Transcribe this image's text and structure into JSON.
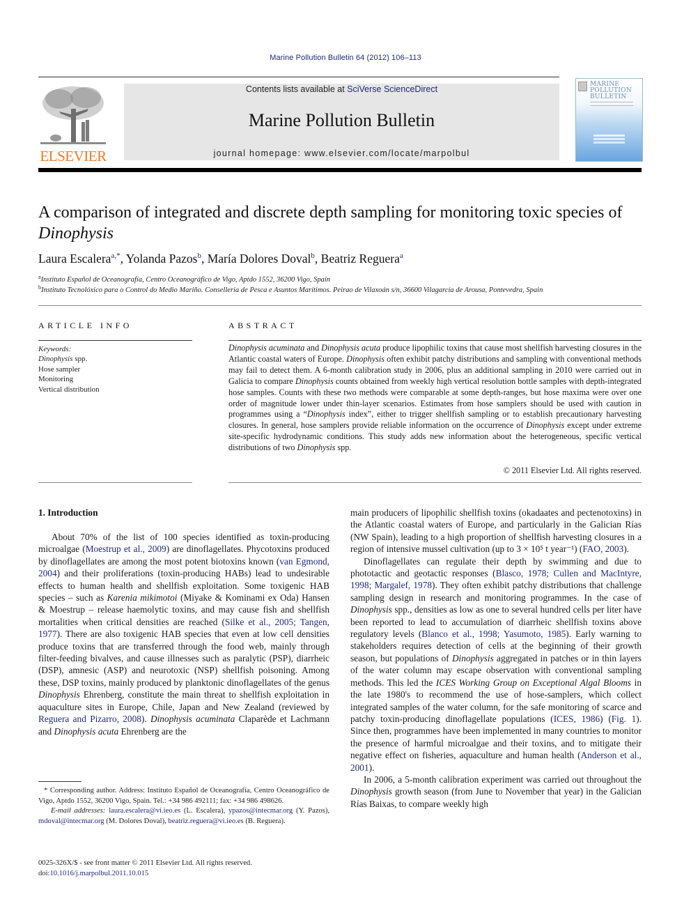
{
  "header": {
    "citation": "Marine Pollution Bulletin 64 (2012) 106–113",
    "contents_prefix": "Contents lists available at ",
    "contents_link": "SciVerse ScienceDirect",
    "journal_title": "Marine Pollution Bulletin",
    "homepage": "journal homepage: www.elsevier.com/locate/marpolbul",
    "publisher_logo_text": "ELSEVIER",
    "cover_title": "MARINE POLLUTION BULLETIN",
    "colors": {
      "link": "#1d2a7a",
      "elsevier_orange": "#f07a24",
      "banner_bg": "#e6e6e6"
    }
  },
  "article": {
    "title_main": "A comparison of integrated and discrete depth sampling for monitoring toxic species of ",
    "title_italic": "Dinophysis",
    "authors": [
      {
        "name": "Laura Escalera",
        "sup": "a,*"
      },
      {
        "name": "Yolanda Pazos",
        "sup": "b"
      },
      {
        "name": "María Dolores Doval",
        "sup": "b"
      },
      {
        "name": "Beatriz Reguera",
        "sup": "a"
      }
    ],
    "affiliations": [
      {
        "sup": "a",
        "text": "Instituto Español de Oceanografía, Centro Oceanográfico de Vigo, Aptdo 1552, 36200 Vigo, Spain"
      },
      {
        "sup": "b",
        "text": "Instituto Tecnolóxico para o Control do Medio Mariño. Conselleria de Pesca e Asuntos Marítimos. Peirao de Vilaxoán s/n, 36600 Vilagarcía de Arousa, Pontevedra, Spain"
      }
    ]
  },
  "article_info": {
    "heading": "ARTICLE INFO",
    "keywords_label": "Keywords:",
    "keywords": [
      "Dinophysis spp.",
      "Hose sampler",
      "Monitoring",
      "Vertical distribution"
    ]
  },
  "abstract": {
    "heading": "ABSTRACT",
    "segments": [
      {
        "t": "Dinophysis acuminata",
        "i": true
      },
      {
        "t": " and ",
        "i": false
      },
      {
        "t": "Dinophysis acuta",
        "i": true
      },
      {
        "t": " produce lipophilic toxins that cause most shellfish harvesting closures in the Atlantic coastal waters of Europe. ",
        "i": false
      },
      {
        "t": "Dinophysis",
        "i": true
      },
      {
        "t": " often exhibit patchy distributions and sampling with conventional methods may fail to detect them. A 6-month calibration study in 2006, plus an additional sampling in 2010 were carried out in Galicia to compare ",
        "i": false
      },
      {
        "t": "Dinophysis",
        "i": true
      },
      {
        "t": " counts obtained from weekly high vertical resolution bottle samples with depth-integrated hose samples. Counts with these two methods were comparable at some depth-ranges, but hose maxima were over one order of magnitude lower under thin-layer scenarios. Estimates from hose samplers should be used with caution in programmes using a “",
        "i": false
      },
      {
        "t": "Dinophysis",
        "i": true
      },
      {
        "t": " index”, either to trigger shellfish sampling or to establish precautionary harvesting closures. In general, hose samplers provide reliable information on the occurrence of ",
        "i": false
      },
      {
        "t": "Dinophysis",
        "i": true
      },
      {
        "t": " except under extreme site-specific hydrodynamic conditions. This study adds new information about the heterogeneous, specific vertical distributions of two ",
        "i": false
      },
      {
        "t": "Dinophysis",
        "i": true
      },
      {
        "t": " spp.",
        "i": false
      }
    ],
    "copyright": "© 2011 Elsevier Ltd. All rights reserved."
  },
  "body": {
    "section_heading": "1. Introduction",
    "left_column": [
      [
        {
          "t": "About 70% of the list of 100 species identified as toxin-producing microalgae (",
          "k": "n"
        },
        {
          "t": "Moestrup et al., 2009",
          "k": "l"
        },
        {
          "t": ") are dinoflagellates. Phycotoxins produced by dinoflagellates are among the most potent biotoxins known (",
          "k": "n"
        },
        {
          "t": "van Egmond, 2004",
          "k": "l"
        },
        {
          "t": ") and their proliferations (toxin-producing HABs) lead to undesirable effects to human health and shellfish exploitation. Some toxigenic HAB species – such as ",
          "k": "n"
        },
        {
          "t": "Karenia mikimotoi",
          "k": "i"
        },
        {
          "t": " (Miyake & Kominami ex Oda) Hansen & Moestrup – release haemolytic toxins, and may cause fish and shellfish mortalities when critical densities are reached (",
          "k": "n"
        },
        {
          "t": "Silke et al., 2005; Tangen, 1977",
          "k": "l"
        },
        {
          "t": "). There are also toxigenic HAB species that even at low cell densities produce toxins that are transferred through the food web, mainly through filter-feeding bivalves, and cause illnesses such as paralytic (PSP), diarrheic (DSP), amnesic (ASP) and neurotoxic (NSP) shellfish poisoning. Among these, DSP toxins, mainly produced by planktonic dinoflagellates of the genus ",
          "k": "n"
        },
        {
          "t": "Dinophysis",
          "k": "i"
        },
        {
          "t": " Ehrenberg, constitute the main threat to shellfish exploitation in aquaculture sites in Europe, Chile, Japan and New Zealand (reviewed by ",
          "k": "n"
        },
        {
          "t": "Reguera and Pizarro, 2008",
          "k": "l"
        },
        {
          "t": "). ",
          "k": "n"
        },
        {
          "t": "Dinophysis acuminata",
          "k": "i"
        },
        {
          "t": " Claparède et Lachmann and ",
          "k": "n"
        },
        {
          "t": "Dinophysis acuta",
          "k": "i"
        },
        {
          "t": " Ehrenberg are the",
          "k": "n"
        }
      ]
    ],
    "right_column": [
      [
        {
          "t": "main producers of lipophilic shellfish toxins (okadaates and pectenotoxins) in the Atlantic coastal waters of Europe, and particularly in the Galician Rías (NW Spain), leading to a high proportion of shellfish harvesting closures in a region of intensive mussel cultivation (up to 3 × 10⁵ t year⁻¹) (",
          "k": "n"
        },
        {
          "t": "FAO, 2003",
          "k": "l"
        },
        {
          "t": ").",
          "k": "n"
        }
      ],
      [
        {
          "t": "Dinoflagellates can regulate their depth by swimming and due to phototactic and geotactic responses (",
          "k": "n"
        },
        {
          "t": "Blasco, 1978; Cullen and MacIntyre, 1998; Margalef, 1978",
          "k": "l"
        },
        {
          "t": "). They often exhibit patchy distributions that challenge sampling design in research and monitoring programmes. In the case of ",
          "k": "n"
        },
        {
          "t": "Dinophysis",
          "k": "i"
        },
        {
          "t": " spp., densities as low as one to several hundred cells per liter have been reported to lead to accumulation of diarrheic shellfish toxins above regulatory levels (",
          "k": "n"
        },
        {
          "t": "Blanco et al., 1998; Yasumoto, 1985",
          "k": "l"
        },
        {
          "t": "). Early warning to stakeholders requires detection of cells at the beginning of their growth season, but populations of ",
          "k": "n"
        },
        {
          "t": "Dinophysis",
          "k": "i"
        },
        {
          "t": " aggregated in patches or in thin layers of the water column may escape observation with conventional sampling methods. This led the ",
          "k": "n"
        },
        {
          "t": "ICES Working Group on Exceptional Algal Blooms",
          "k": "i"
        },
        {
          "t": " in the late 1980's to recommend the use of hose-samplers, which collect integrated samples of the water column, for the safe monitoring of scarce and patchy toxin-producing dinoflagellate populations (",
          "k": "n"
        },
        {
          "t": "ICES, 1986",
          "k": "l"
        },
        {
          "t": ") (",
          "k": "n"
        },
        {
          "t": "Fig. 1",
          "k": "l"
        },
        {
          "t": "). Since then, programmes have been implemented in many countries to monitor the presence of harmful microalgae and their toxins, and to mitigate their negative effect on fisheries, aquaculture and human health (",
          "k": "n"
        },
        {
          "t": "Anderson et al., 2001",
          "k": "l"
        },
        {
          "t": ").",
          "k": "n"
        }
      ],
      [
        {
          "t": "In 2006, a 5-month calibration experiment was carried out throughout the ",
          "k": "n"
        },
        {
          "t": "Dinophysis",
          "k": "i"
        },
        {
          "t": " growth season (from June to November that year) in the Galician Rías Baixas, to compare weekly high",
          "k": "n"
        }
      ]
    ]
  },
  "footnotes": {
    "corresponding": "* Corresponding author. Address: Instituto Español de Oceanografía, Centro Oceanográfico de Vigo, Aptdo 1552, 36200 Vigo, Spain. Tel.: +34 986 492111; fax: +34 986 498626.",
    "email_label": "E-mail addresses:",
    "emails": [
      {
        "addr": "laura.escalera@vi.ieo.es",
        "who": " (L. Escalera), "
      },
      {
        "addr": "ypazos@intecmar.org",
        "who": " (Y. Pazos), "
      },
      {
        "addr": "mdoval@intecmar.org",
        "who": " (M. Dolores Doval), "
      },
      {
        "addr": "beatriz.reguera@vi.ieo.es",
        "who": " (B. Reguera)."
      }
    ],
    "issn": "0025-326X/$ - see front matter © 2011 Elsevier Ltd. All rights reserved.",
    "doi_label": "doi:",
    "doi": "10.1016/j.marpolbul.2011.10.015"
  }
}
